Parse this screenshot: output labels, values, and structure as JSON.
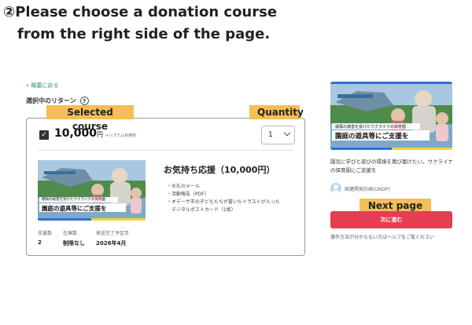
{
  "instruction": {
    "line1": "②Please choose a donation course",
    "line2": "from the right side of the page."
  },
  "callouts": {
    "selected_course": "Selected course",
    "quantity": "Quantity",
    "next_page": "Next page"
  },
  "left_panel": {
    "back_link": "« 概要に戻る",
    "section_label": "選択中のリターン",
    "help_icon_glyph": "?",
    "price": "10,000",
    "price_unit": "円",
    "price_fee_note": "+システム利用料",
    "quantity_value": "1",
    "course_title": "お気持ち応援（10,000円）",
    "benefits": [
      "お礼のメール",
      "活動報告（PDF）",
      "オデーサ市の子どもたちが書いたイラストが入った",
      "デジタルポストカード（1枚）"
    ],
    "stats": {
      "supporters_label": "支援数",
      "supporters_value": "2",
      "stock_label": "在庫数",
      "stock_value": "制限なし",
      "delivery_label": "発送完了予定月",
      "delivery_value": "2026年4月"
    }
  },
  "thumbnail": {
    "caption_small": "爆風の被害を受けたウクライナの保育園",
    "caption_main": "園庭の遊具等にご支援を"
  },
  "right_panel": {
    "description": "園児に学びと遊びの環境を再び届けたい。ウクライナの保育園にご支援を",
    "organization": "国連開発計画(UNDP)",
    "next_button": "次に進む",
    "help_prefix": "操作方法が分からない方は",
    "help_link": "ヘルプ",
    "help_suffix": "をご覧ください"
  },
  "colors": {
    "callout": "#f5be56",
    "next_button": "#e33e52",
    "link": "#2b8a7e",
    "flag_blue": "#2f6fd6",
    "flag_yellow": "#f6d13b"
  }
}
